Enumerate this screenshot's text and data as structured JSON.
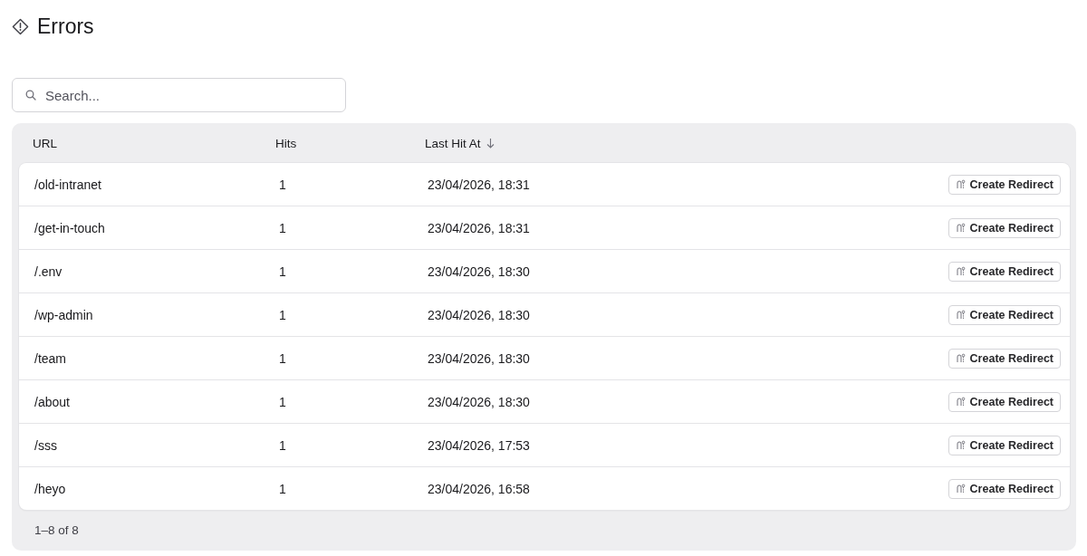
{
  "page": {
    "title": "Errors"
  },
  "search": {
    "placeholder": "Search..."
  },
  "table": {
    "columns": [
      {
        "label": "URL",
        "sorted": false
      },
      {
        "label": "Hits",
        "sorted": false
      },
      {
        "label": "Last Hit At",
        "sorted": true
      }
    ],
    "rows": [
      {
        "url": "/old-intranet",
        "hits": "1",
        "last_hit_at": "23/04/2026, 18:31",
        "action": "Create Redirect"
      },
      {
        "url": "/get-in-touch",
        "hits": "1",
        "last_hit_at": "23/04/2026, 18:31",
        "action": "Create Redirect"
      },
      {
        "url": "/.env",
        "hits": "1",
        "last_hit_at": "23/04/2026, 18:30",
        "action": "Create Redirect"
      },
      {
        "url": "/wp-admin",
        "hits": "1",
        "last_hit_at": "23/04/2026, 18:30",
        "action": "Create Redirect"
      },
      {
        "url": "/team",
        "hits": "1",
        "last_hit_at": "23/04/2026, 18:30",
        "action": "Create Redirect"
      },
      {
        "url": "/about",
        "hits": "1",
        "last_hit_at": "23/04/2026, 18:30",
        "action": "Create Redirect"
      },
      {
        "url": "/sss",
        "hits": "1",
        "last_hit_at": "23/04/2026, 17:53",
        "action": "Create Redirect"
      },
      {
        "url": "/heyo",
        "hits": "1",
        "last_hit_at": "23/04/2026, 16:58",
        "action": "Create Redirect"
      }
    ],
    "pagination": "1–8 of 8"
  }
}
